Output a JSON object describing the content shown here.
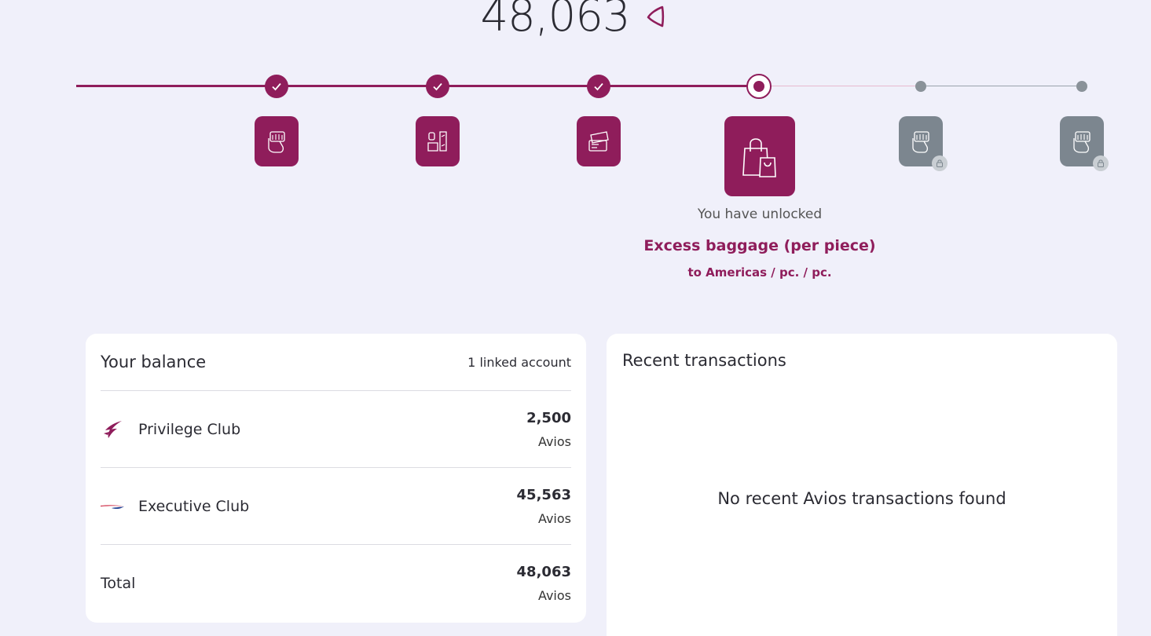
{
  "hero": {
    "balance": "48,063",
    "icon": "avios-icon"
  },
  "progress": {
    "milestones": [
      {
        "status": "done",
        "icon": "fist-ticket-icon"
      },
      {
        "status": "done",
        "icon": "seat-upgrade-icon"
      },
      {
        "status": "done",
        "icon": "tickets-icon"
      },
      {
        "status": "current",
        "icon": "shopping-bags-icon"
      },
      {
        "status": "locked",
        "icon": "fist-ticket-icon"
      },
      {
        "status": "locked",
        "icon": "fist-ticket-icon"
      }
    ],
    "unlocked_lead": "You have unlocked",
    "unlocked_title": "Excess baggage (per piece)",
    "unlocked_subtitle": "to Americas / pc. / pc."
  },
  "balance": {
    "title": "Your balance",
    "linked_accounts": "1 linked account",
    "accounts": [
      {
        "name": "Privilege Club",
        "amount": "2,500",
        "unit": "Avios",
        "logo": "privilege-club-logo"
      },
      {
        "name": "Executive Club",
        "amount": "45,563",
        "unit": "Avios",
        "logo": "executive-club-logo"
      }
    ],
    "total": {
      "label": "Total",
      "amount": "48,063",
      "unit": "Avios"
    }
  },
  "transactions": {
    "title": "Recent transactions",
    "empty_message": "No recent Avios transactions found"
  },
  "colors": {
    "brand": "#8f1d5b",
    "locked": "#7c868f",
    "background": "#f0f0fa"
  }
}
